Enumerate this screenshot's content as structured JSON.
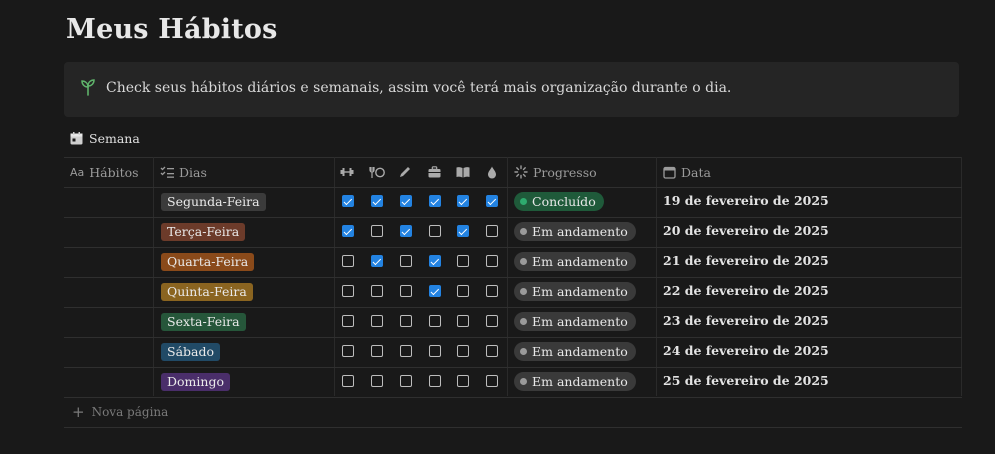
{
  "page": {
    "title": "Meus Hábitos"
  },
  "callout": {
    "icon": "sprout-icon",
    "text": "Check seus hábitos diários e semanais, assim você terá mais organização durante o dia."
  },
  "view": {
    "icon": "calendar-icon",
    "label": "Semana"
  },
  "columns": {
    "habitos": "Hábitos",
    "dias": "Dias",
    "habit_icons": [
      "dumbbell-icon",
      "fork-plate-icon",
      "pencil-icon",
      "briefcase-icon",
      "book-icon",
      "water-drop-icon"
    ],
    "progresso": "Progresso",
    "data": "Data"
  },
  "colors": {
    "checkbox_checked": "#2383e2",
    "concluido_bg": "#1f5a3a",
    "concluido_dot": "#2eab6e",
    "andamento_bg": "#3a3a3a",
    "andamento_dot": "#9b9b9b"
  },
  "rows": [
    {
      "day": "Segunda-Feira",
      "tag_color": "#3b3b3b",
      "checks": [
        true,
        true,
        true,
        true,
        true,
        true
      ],
      "status": "Concluído",
      "status_type": "done",
      "date": "19 de fevereiro de 2025"
    },
    {
      "day": "Terça-Feira",
      "tag_color": "#6c3b2a",
      "checks": [
        true,
        false,
        true,
        false,
        true,
        false
      ],
      "status": "Em andamento",
      "status_type": "progress",
      "date": "20 de fevereiro de 2025"
    },
    {
      "day": "Quarta-Feira",
      "tag_color": "#8a4a1a",
      "checks": [
        false,
        true,
        false,
        true,
        false,
        false
      ],
      "status": "Em andamento",
      "status_type": "progress",
      "date": "21 de fevereiro de 2025"
    },
    {
      "day": "Quinta-Feira",
      "tag_color": "#8a6420",
      "checks": [
        false,
        false,
        false,
        true,
        false,
        false
      ],
      "status": "Em andamento",
      "status_type": "progress",
      "date": "22 de fevereiro de 2025"
    },
    {
      "day": "Sexta-Feira",
      "tag_color": "#26563a",
      "checks": [
        false,
        false,
        false,
        false,
        false,
        false
      ],
      "status": "Em andamento",
      "status_type": "progress",
      "date": "23 de fevereiro de 2025"
    },
    {
      "day": "Sábado",
      "tag_color": "#214a66",
      "checks": [
        false,
        false,
        false,
        false,
        false,
        false
      ],
      "status": "Em andamento",
      "status_type": "progress",
      "date": "24 de fevereiro de 2025"
    },
    {
      "day": "Domingo",
      "tag_color": "#4a2e6a",
      "checks": [
        false,
        false,
        false,
        false,
        false,
        false
      ],
      "status": "Em andamento",
      "status_type": "progress",
      "date": "25 de fevereiro de 2025"
    }
  ],
  "footer": {
    "new_page": "Nova página"
  }
}
